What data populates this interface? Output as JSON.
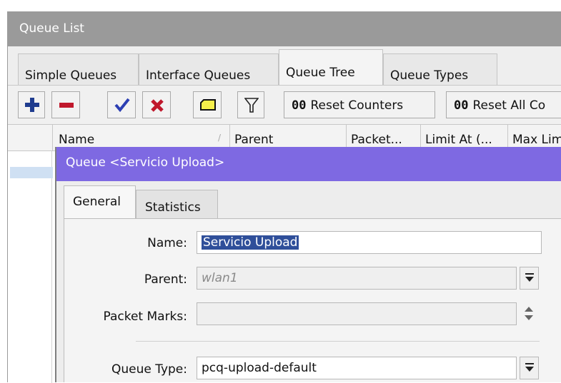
{
  "window": {
    "title": "Queue List"
  },
  "tabs": [
    {
      "label": "Simple Queues",
      "active": false
    },
    {
      "label": "Interface Queues",
      "active": false
    },
    {
      "label": "Queue Tree",
      "active": true
    },
    {
      "label": "Queue Types",
      "active": false
    }
  ],
  "toolbar": {
    "add": "add-icon",
    "remove": "remove-icon",
    "enable": "check-icon",
    "disable": "x-icon",
    "comment": "comment-icon",
    "filter": "filter-icon",
    "reset_counters_prefix": "00",
    "reset_counters_label": "Reset Counters",
    "reset_all_prefix": "00",
    "reset_all_label": "Reset All Co"
  },
  "columns": [
    "Name",
    "Parent",
    "Packet...",
    "Limit At (...",
    "Max Lim"
  ],
  "sort_indicator": "/",
  "dialog": {
    "title": "Queue <Servicio Upload>",
    "tabs": [
      "General",
      "Statistics"
    ],
    "fields": {
      "name_label": "Name:",
      "name_value": "Servicio Upload",
      "parent_label": "Parent:",
      "parent_value": "wlan1",
      "packet_marks_label": "Packet Marks:",
      "packet_marks_value": "",
      "queue_type_label": "Queue Type:",
      "queue_type_value": "pcq-upload-default"
    }
  },
  "colors": {
    "title_bar": "#9a9a9a",
    "dialog_title_bar": "#7e69e2",
    "selection": "#2f4f9a",
    "add_icon": "#1f3c8f",
    "remove_icon": "#c0182c",
    "check_icon": "#2c3fb3",
    "x_icon": "#c0182c",
    "comment_icon": "#f6ef4b"
  }
}
